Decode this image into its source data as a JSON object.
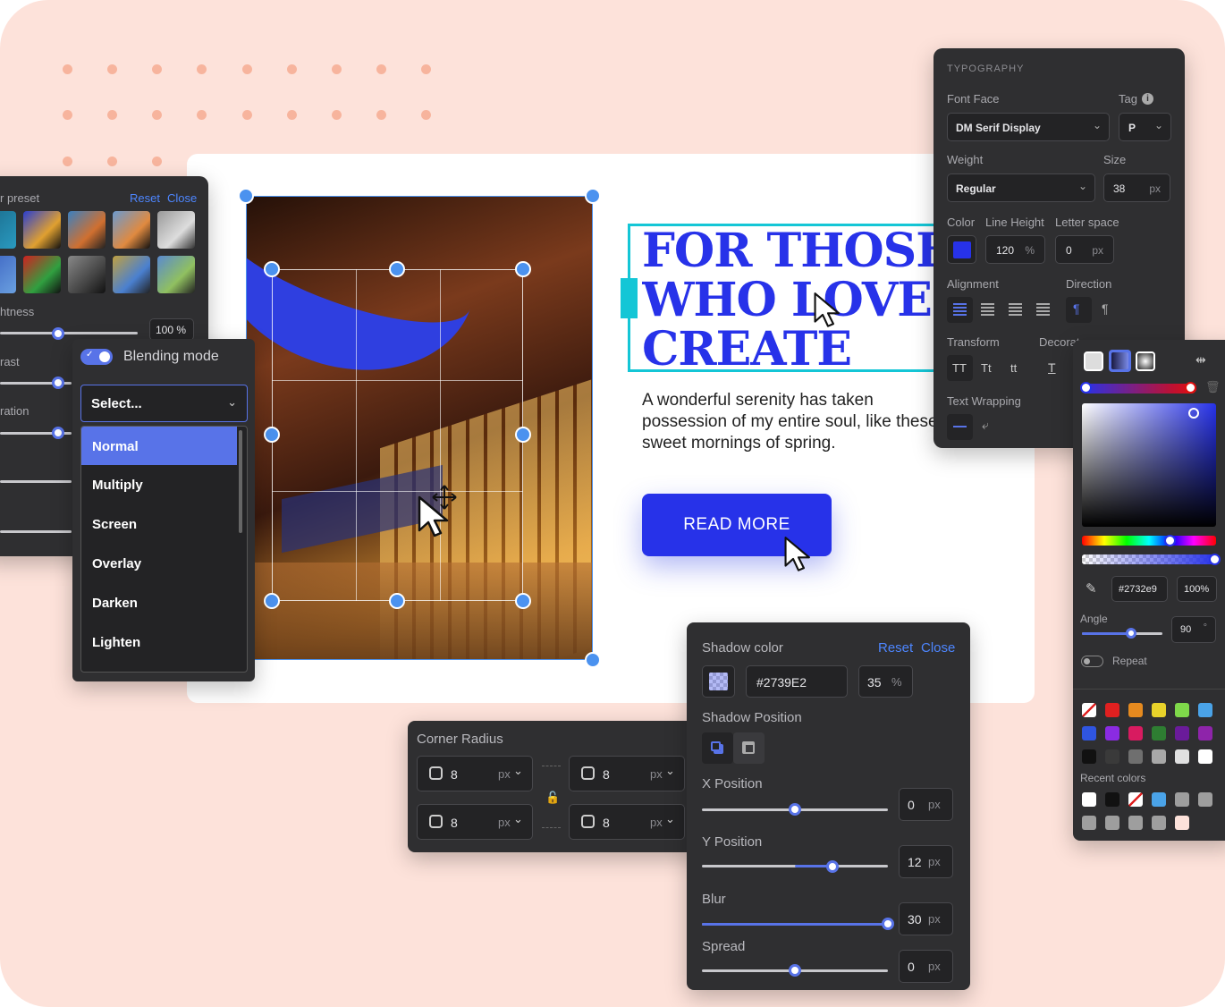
{
  "colors": {
    "background": "#fde2da",
    "accent": "#2732e9",
    "panel": "#2f2f31",
    "highlight": "#5873e8",
    "frame": "#14c6d6"
  },
  "hero": {
    "headline_1": "FOR THOSE",
    "headline_2": "WHO LOVE T",
    "headline_3": "CREATE",
    "body_1": "A wonderful serenity has taken",
    "body_2": "possession of my entire soul, like these",
    "body_3": "sweet mornings of spring.",
    "cta": "READ MORE"
  },
  "filters": {
    "title": "r preset",
    "reset": "Reset",
    "close": "Close",
    "brightness": "htness",
    "brightness_value": "100 %",
    "contrast": "rast",
    "saturation": "ration"
  },
  "blend": {
    "title": "Blending mode",
    "select": "Select...",
    "options": [
      "Normal",
      "Multiply",
      "Screen",
      "Overlay",
      "Darken",
      "Lighten"
    ],
    "selected": "Normal"
  },
  "typography": {
    "title": "TYPOGRAPHY",
    "font_face_label": "Font Face",
    "font_face": "DM Serif Display",
    "tag_label": "Tag",
    "tag": "P",
    "weight_label": "Weight",
    "weight": "Regular",
    "size_label": "Size",
    "size": "38",
    "size_unit": "px",
    "color_label": "Color",
    "line_height_label": "Line Height",
    "line_height": "120",
    "line_height_unit": "%",
    "letter_label": "Letter space",
    "letter": "0",
    "letter_unit": "px",
    "alignment_label": "Alignment",
    "direction_label": "Direction",
    "transform_label": "Transform",
    "transform_options": [
      "TT",
      "Tt",
      "tt"
    ],
    "decoration_label": "Decorat",
    "decoration_option": "T",
    "wrapping_label": "Text Wrapping"
  },
  "color_picker": {
    "hex": "#2732e9",
    "opacity": "100%",
    "angle_label": "Angle",
    "angle": "90",
    "angle_unit": "°",
    "repeat": "Repeat",
    "recent_label": "Recent colors",
    "swatches": [
      "#e5e5e5",
      "#e02020",
      "#e58a1f",
      "#e8d22a",
      "#7fd84a",
      "#4aa3e8",
      "#2f55e0",
      "#8a2be2",
      "#d81b60",
      "#2e7d32",
      "#6a1b9a",
      "#8e24aa",
      "#111111",
      "#3a3a3a",
      "#6f6f6f",
      "#a8a8a8",
      "#e0e0e0",
      "#ffffff"
    ],
    "recent": [
      "#ffffff",
      "#111111",
      "#e02020",
      "#4aa3e8",
      "#9e9e9e",
      "#9e9e9e",
      "#9e9e9e",
      "#9e9e9e",
      "#9e9e9e",
      "#9e9e9e",
      "#fde2da"
    ]
  },
  "shadow": {
    "title": "Shadow color",
    "reset": "Reset",
    "close": "Close",
    "hex": "#2739E2",
    "opacity": "35",
    "opacity_unit": "%",
    "position_label": "Shadow Position",
    "x_label": "X Position",
    "x_value": "0",
    "y_label": "Y Position",
    "y_value": "12",
    "blur_label": "Blur",
    "blur_value": "30",
    "spread_label": "Spread",
    "spread_value": "0",
    "unit": "px"
  },
  "corner": {
    "title": "Corner Radius",
    "tl": "8",
    "tr": "8",
    "bl": "8",
    "br": "8",
    "unit": "px"
  }
}
